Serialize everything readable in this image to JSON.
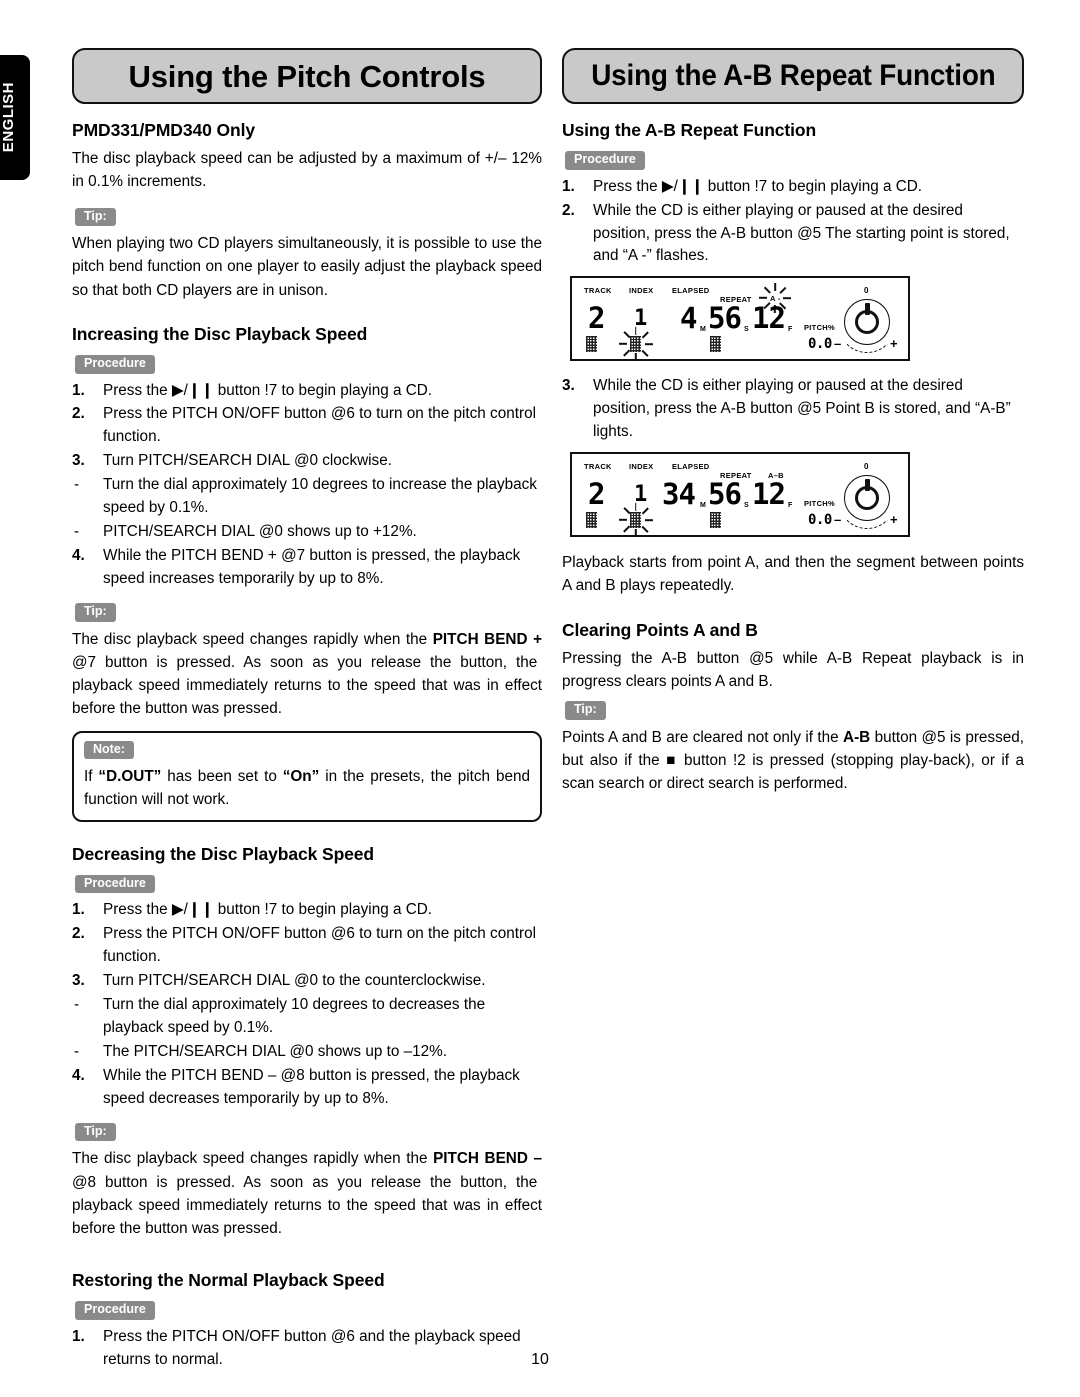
{
  "language_tab": "ENGLISH",
  "page_number": "10",
  "left_column": {
    "banner_title": "Using the Pitch Controls",
    "heading_model": "PMD331/PMD340 Only",
    "intro": "The disc playback speed can be adjusted by a maximum of +/– 12% in 0.1% increments.",
    "tip_label_1": "Tip:",
    "tip_1": "When playing two CD players simultaneously, it is possible to use the pitch bend function on one player to easily adjust the playback speed so that both CD players are in unison.",
    "heading_increase": "Increasing the Disc Playback Speed",
    "procedure_label_1": "Procedure",
    "increase_steps": [
      {
        "marker": "1.",
        "text": "Press the ▶/❙❙ button !7 to begin playing a CD."
      },
      {
        "marker": "2.",
        "text": "Press the PITCH ON/OFF button @6 to turn on the pitch control function."
      },
      {
        "marker": "3.",
        "text": "Turn PITCH/SEARCH DIAL @0 clockwise."
      },
      {
        "marker": "-",
        "text": "Turn the dial approximately 10 degrees to increase the playback speed by 0.1%."
      },
      {
        "marker": "-",
        "text": "PITCH/SEARCH DIAL @0 shows up to +12%."
      },
      {
        "marker": "4.",
        "text": "While the PITCH BEND + @7 button is pressed, the playback speed increases temporarily by up to 8%."
      }
    ],
    "tip_label_2": "Tip:",
    "tip_2_pre": "The disc playback speed changes rapidly when the ",
    "tip_2_bold": "PITCH BEND +",
    "tip_2_ref": " @7 ",
    "tip_2_post": "button is pressed.  As soon as you release the button, the playback speed immediately returns to the speed that was in effect before the button was pressed.",
    "note_label": "Note:",
    "note_pre": "If ",
    "note_b1": "“D.OUT”",
    "note_mid": " has been set to ",
    "note_b2": "“On”",
    "note_post": " in the presets, the pitch bend function will not work.",
    "heading_decrease": "Decreasing the Disc Playback Speed",
    "procedure_label_2": "Procedure",
    "decrease_steps": [
      {
        "marker": "1.",
        "text": "Press the ▶/❙❙ button !7 to begin playing a CD."
      },
      {
        "marker": "2.",
        "text": "Press the PITCH ON/OFF button @6 to turn on the pitch control function."
      },
      {
        "marker": "3.",
        "text": "Turn PITCH/SEARCH DIAL @0 to the counterclockwise."
      },
      {
        "marker": "-",
        "text": "Turn the dial approximately 10 degrees to decreases the playback speed by 0.1%."
      },
      {
        "marker": "-",
        "text": "The PITCH/SEARCH DIAL @0 shows up to –12%."
      },
      {
        "marker": "4.",
        "text": "While the PITCH BEND – @8 button is pressed, the playback speed decreases temporarily by up to 8%."
      }
    ],
    "tip_label_3": "Tip:",
    "tip_3_pre": "The disc playback speed changes rapidly when the ",
    "tip_3_bold": "PITCH BEND –",
    "tip_3_ref": " @8 ",
    "tip_3_post": "button is pressed.  As soon as you release the button, the playback speed immediately returns to the speed that was in effect before the button was pressed.",
    "heading_restore": "Restoring the Normal Playback Speed",
    "procedure_label_3": "Procedure",
    "restore_steps": [
      {
        "marker": "1.",
        "text": "Press the PITCH ON/OFF button @6 and the playback speed returns to normal."
      }
    ]
  },
  "right_column": {
    "banner_title": "Using the A-B Repeat Function",
    "heading_ab": "Using the A-B Repeat Function",
    "procedure_label_1": "Procedure",
    "ab_steps": [
      {
        "marker": "1.",
        "text": "Press the ▶/❙❙ button !7 to begin playing a CD."
      },
      {
        "marker": "2.",
        "text": "While the CD is either playing or paused at the desired position, press the A-B button @5 The starting point is stored, and “A -” flashes."
      }
    ],
    "ab_step3": {
      "marker": "3.",
      "text": "While the CD is either playing or paused at the desired position, press the A-B button @5 Point B is stored, and “A-B” lights."
    },
    "after_text": "Playback starts from point A, and then the segment between points A and B plays repeatedly.",
    "heading_clear": "Clearing Points A and B",
    "clear_text": "Pressing the A-B button @5 while A-B Repeat playback is in progress clears points A and B.",
    "tip_label": "Tip:",
    "tip_pre": "Points A and B are cleared not only if the ",
    "tip_b1": "A-B",
    "tip_mid": " button @5 is pressed, but also if the ■ button !2 is pressed (stopping play-back), or if a scan search or direct search is performed.",
    "display_1": {
      "track_label": "TRACK",
      "index_label": "INDEX",
      "elapsed_label": "ELAPSED",
      "repeat_label": "REPEAT",
      "ab_label": "A -",
      "track_value": "2",
      "index_value": "1",
      "minutes": "4",
      "minutes_unit": "M",
      "seconds": "56",
      "seconds_unit": "S",
      "frames": "12",
      "frames_unit": "F",
      "pitch_label": "PITCH%",
      "pitch_value": "0.0",
      "knob_zero": "0",
      "knob_minus": "–",
      "knob_plus": "+",
      "ab_flashing": true
    },
    "display_2": {
      "track_label": "TRACK",
      "index_label": "INDEX",
      "elapsed_label": "ELAPSED",
      "repeat_label": "REPEAT",
      "ab_label": "A–B",
      "track_value": "2",
      "index_value": "1",
      "minutes": "34",
      "minutes_unit": "M",
      "seconds": "56",
      "seconds_unit": "S",
      "frames": "12",
      "frames_unit": "F",
      "pitch_label": "PITCH%",
      "pitch_value": "0.0",
      "knob_zero": "0",
      "knob_minus": "–",
      "knob_plus": "+",
      "ab_flashing": false
    }
  }
}
